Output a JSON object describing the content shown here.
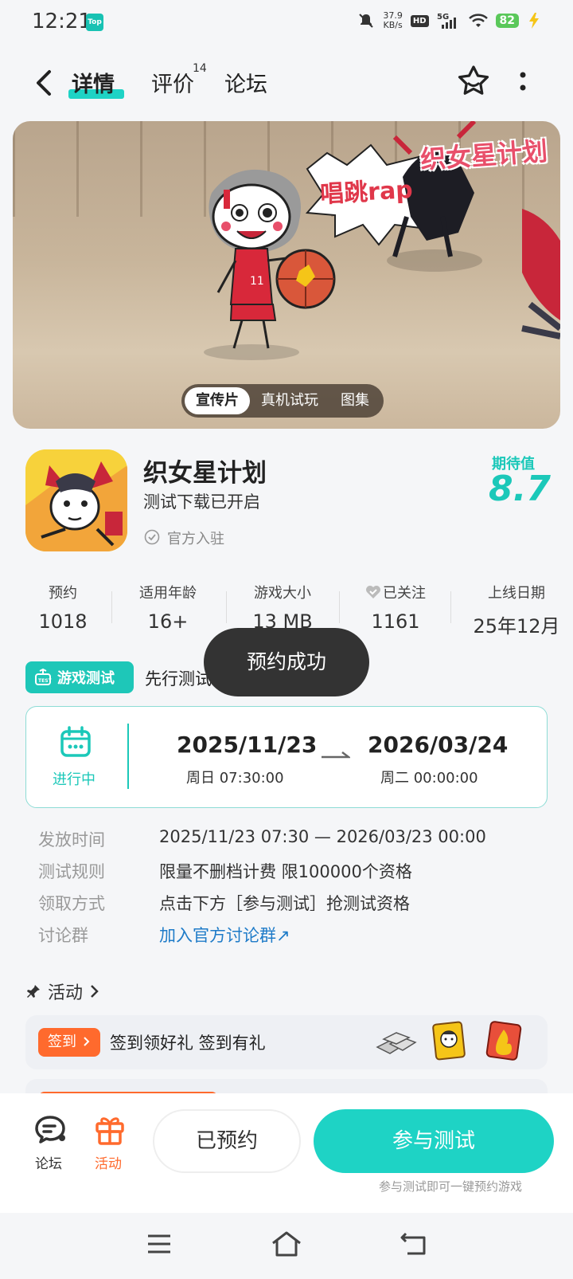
{
  "status_bar": {
    "time": "12:21",
    "app_badge": "Top",
    "speed_value": "37.9",
    "speed_unit": "KB/s",
    "hd": "HD",
    "network": "5G",
    "battery": "82"
  },
  "header": {
    "tabs": [
      {
        "label": "详情"
      },
      {
        "label": "评价",
        "count": "14"
      },
      {
        "label": "论坛"
      }
    ]
  },
  "banner": {
    "logo_text": "织女星计划",
    "burst_text": "唱跳rap",
    "tabs": [
      {
        "label": "宣传片"
      },
      {
        "label": "真机试玩"
      },
      {
        "label": "图集"
      }
    ]
  },
  "app": {
    "name": "织女星计划",
    "subtitle": "测试下载已开启",
    "verified": "官方入驻",
    "expect_label": "期待值",
    "expect_score": "8.7"
  },
  "stats": [
    {
      "label": "预约",
      "value": "1018"
    },
    {
      "label": "适用年龄",
      "value": "16+"
    },
    {
      "label": "游戏大小",
      "value": "13 MB"
    },
    {
      "label": "已关注",
      "value": "1161"
    },
    {
      "label": "上线日期",
      "value": "25年12月"
    }
  ],
  "toast": "预约成功",
  "test": {
    "badge": "游戏测试",
    "title": "先行测试",
    "status": "进行中",
    "start_date": "2025/11/23",
    "start_time": "周日  07:30:00",
    "end_date": "2026/03/24",
    "end_time": "周二  00:00:00",
    "rows": [
      {
        "label": "发放时间",
        "value": "2025/11/23 07:30 — 2026/03/23 00:00"
      },
      {
        "label": "测试规则",
        "value": "限量不删档计费 限100000个资格"
      },
      {
        "label": "领取方式",
        "value": "点击下方［参与测试］抢测试资格"
      },
      {
        "label": "讨论群",
        "value": "加入官方讨论群↗"
      }
    ]
  },
  "activity": {
    "header": "活动",
    "checkin_badge": "签到",
    "checkin_text": "签到领好礼 签到有礼"
  },
  "bottom": {
    "forum_label": "论坛",
    "activity_label": "活动",
    "reserved_label": "已预约",
    "join_label": "参与测试",
    "join_hint": "参与测试即可一键预约游戏"
  },
  "colors": {
    "accent": "#1ed3c5",
    "orange": "#ff6a2d",
    "link": "#1e7bc8"
  }
}
